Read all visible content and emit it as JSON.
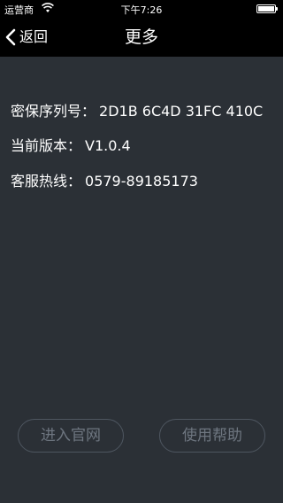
{
  "status_bar": {
    "carrier": "运营商",
    "time": "下午7:26",
    "battery_level": 1.0
  },
  "nav": {
    "back_label": "返回",
    "title": "更多"
  },
  "info": [
    {
      "label": "密保序列号：",
      "value": "2D1B 6C4D 31FC 410C"
    },
    {
      "label": "当前版本：",
      "value": "V1.0.4"
    },
    {
      "label": "客服热线：",
      "value": "0579-89185173"
    }
  ],
  "buttons": {
    "website": "进入官网",
    "help": "使用帮助"
  },
  "colors": {
    "background": "#2b3036",
    "bar": "#000000",
    "button_border": "#4e5660",
    "button_text": "#6e7680"
  }
}
